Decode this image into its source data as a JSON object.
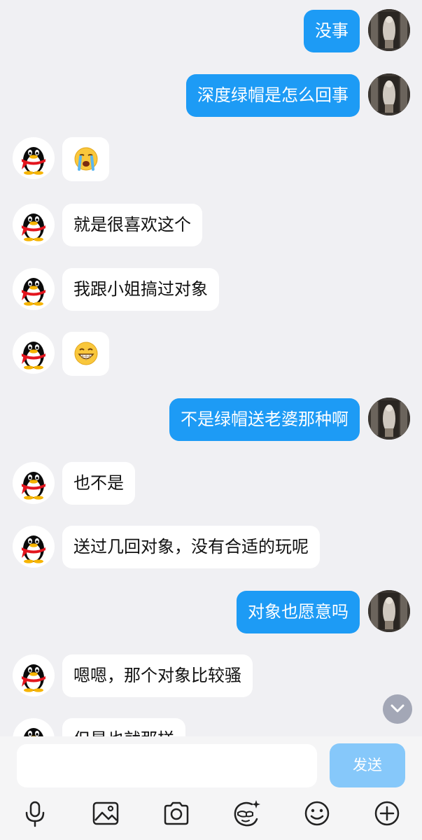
{
  "colors": {
    "background": "#f0f0f3",
    "my_bubble": "#1d9bf5",
    "peer_bubble": "#ffffff",
    "send_button": "#86c8fa"
  },
  "messages": [
    {
      "sender": "me",
      "text": "没事"
    },
    {
      "sender": "me",
      "text": "深度绿帽是怎么回事"
    },
    {
      "sender": "peer",
      "emoji": "crying-face"
    },
    {
      "sender": "peer",
      "text": "就是很喜欢这个"
    },
    {
      "sender": "peer",
      "text": "我跟小姐搞过对象"
    },
    {
      "sender": "peer",
      "emoji": "grinning-face"
    },
    {
      "sender": "me",
      "text": "不是绿帽送老婆那种啊"
    },
    {
      "sender": "peer",
      "text": "也不是"
    },
    {
      "sender": "peer",
      "text": "送过几回对象，没有合适的玩呢"
    },
    {
      "sender": "me",
      "text": "对象也愿意吗"
    },
    {
      "sender": "peer",
      "text": "嗯嗯，那个对象比较骚"
    },
    {
      "sender": "peer",
      "text": "但是也就那样"
    }
  ],
  "composer": {
    "input_value": "",
    "send_label": "发送"
  },
  "toolbar": {
    "icons": [
      "microphone-icon",
      "image-icon",
      "camera-icon",
      "sticker-icon",
      "emoji-icon",
      "plus-icon"
    ]
  }
}
